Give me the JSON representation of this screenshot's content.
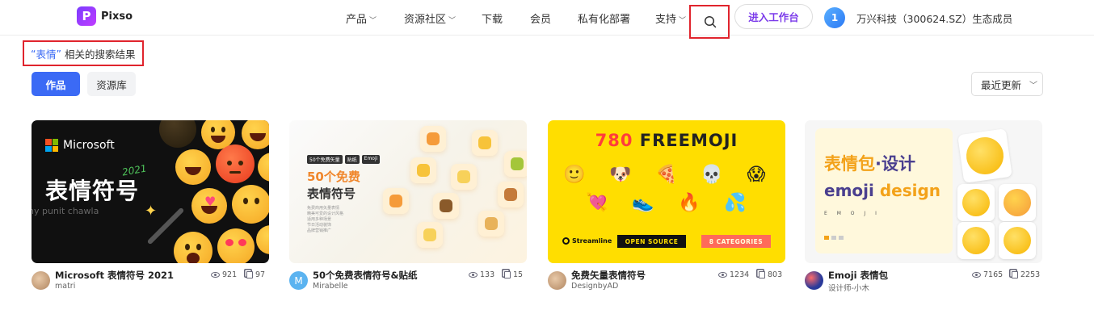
{
  "header": {
    "logo_text": "Pixso",
    "nav": [
      {
        "label": "产品",
        "has_dropdown": true
      },
      {
        "label": "资源社区",
        "has_dropdown": true
      },
      {
        "label": "下载",
        "has_dropdown": false
      },
      {
        "label": "会员",
        "has_dropdown": false
      },
      {
        "label": "私有化部署",
        "has_dropdown": false
      },
      {
        "label": "支持",
        "has_dropdown": true
      }
    ],
    "search_icon": "search-icon",
    "cta_label": "进入工作台",
    "eco_badge": "1",
    "eco_text": "万兴科技（300624.SZ）生态成员"
  },
  "search_result": {
    "open_quote": "“",
    "keyword": "表情",
    "close_quote": "”",
    "suffix": " 相关的搜索结果"
  },
  "tabs": [
    {
      "label": "作品",
      "active": true
    },
    {
      "label": "资源库",
      "active": false
    }
  ],
  "sort": {
    "label": "最近更新"
  },
  "cards": [
    {
      "title": "Microsoft 表情符号 2021",
      "author": "matri",
      "views": "921",
      "copies": "97",
      "thumb": {
        "brand": "Microsoft",
        "headline": "表情符号",
        "year": "2021",
        "byline": "ny punit chawla"
      }
    },
    {
      "title": "50个免费表情符号&贴纸",
      "author": "Mirabelle",
      "views": "133",
      "copies": "15",
      "avatar_letter": "M",
      "thumb": {
        "chips": [
          "50个免费矢量",
          "贴纸",
          "Emoji"
        ],
        "line1": "50个免费",
        "line2": "表情符号",
        "body": [
          "免费商用矢量表情",
          "精美可爱的设计风格",
          "适用多种场景",
          "节日活动装饰",
          "品牌营销推广"
        ]
      }
    },
    {
      "title": "免费矢量表情符号",
      "author": "DesignbyAD",
      "views": "1234",
      "copies": "803",
      "thumb": {
        "num": "780",
        "word": "FREEMOJI",
        "brand": "Streamline",
        "tag1": "OPEN SOURCE",
        "tag2": "8 CATEGORIES"
      }
    },
    {
      "title": "Emoji 表情包",
      "author": "设计师-小木",
      "views": "7165",
      "copies": "2253",
      "thumb": {
        "line1a": "表情包",
        "line1b": "·设计",
        "line2a": "emoji",
        "line2b": "design",
        "letters": "E M O J I"
      }
    }
  ],
  "colors": {
    "accent": "#3b6af5",
    "cta": "#7b3bea",
    "highlight": "#e0242d"
  }
}
